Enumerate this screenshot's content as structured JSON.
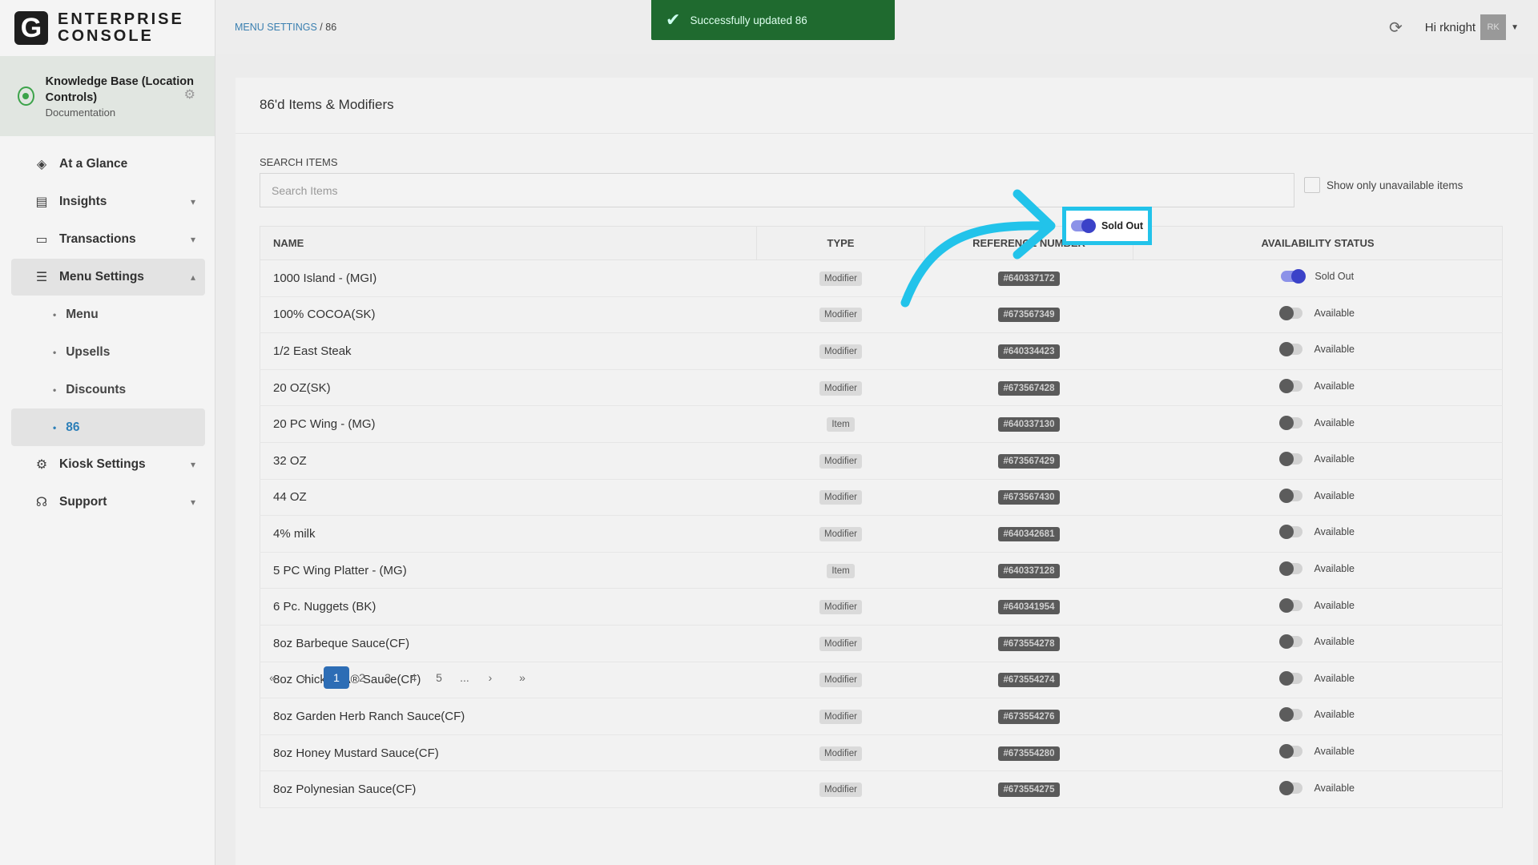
{
  "logo": {
    "mark": "G",
    "line1": "ENTERPRISE",
    "line2": "CONSOLE"
  },
  "location": {
    "name": "Knowledge Base (Location Controls)",
    "sub": "Documentation"
  },
  "nav": {
    "at_a_glance": "At a Glance",
    "insights": "Insights",
    "transactions": "Transactions",
    "menu_settings": "Menu Settings",
    "sub_menu": "Menu",
    "sub_upsells": "Upsells",
    "sub_discounts": "Discounts",
    "sub_86": "86",
    "kiosk_settings": "Kiosk Settings",
    "support": "Support"
  },
  "breadcrumb": {
    "parent": "MENU SETTINGS",
    "sep": "/",
    "current": "86"
  },
  "toast": {
    "message": "Successfully updated 86"
  },
  "user": {
    "greeting": "Hi rknight",
    "initials": "RK"
  },
  "page": {
    "title": "86'd Items & Modifiers",
    "search_label": "SEARCH ITEMS",
    "search_placeholder": "Search Items",
    "only_unavailable": "Show only unavailable items"
  },
  "table": {
    "headers": {
      "name": "NAME",
      "type": "TYPE",
      "ref": "REFERENCE NUMBER",
      "status": "AVAILABILITY STATUS"
    },
    "rows": [
      {
        "name": "1000 Island - (MGI)",
        "type": "Modifier",
        "ref": "#640337172",
        "status": "Sold Out",
        "on": true
      },
      {
        "name": "100% COCOA(SK)",
        "type": "Modifier",
        "ref": "#673567349",
        "status": "Available",
        "on": false
      },
      {
        "name": "1/2 East Steak",
        "type": "Modifier",
        "ref": "#640334423",
        "status": "Available",
        "on": false
      },
      {
        "name": "20 OZ(SK)",
        "type": "Modifier",
        "ref": "#673567428",
        "status": "Available",
        "on": false
      },
      {
        "name": "20 PC Wing - (MG)",
        "type": "Item",
        "ref": "#640337130",
        "status": "Available",
        "on": false
      },
      {
        "name": "32 OZ",
        "type": "Modifier",
        "ref": "#673567429",
        "status": "Available",
        "on": false
      },
      {
        "name": "44 OZ",
        "type": "Modifier",
        "ref": "#673567430",
        "status": "Available",
        "on": false
      },
      {
        "name": "4% milk",
        "type": "Modifier",
        "ref": "#640342681",
        "status": "Available",
        "on": false
      },
      {
        "name": "5 PC Wing Platter - (MG)",
        "type": "Item",
        "ref": "#640337128",
        "status": "Available",
        "on": false
      },
      {
        "name": "6 Pc. Nuggets (BK)",
        "type": "Modifier",
        "ref": "#640341954",
        "status": "Available",
        "on": false
      },
      {
        "name": "8oz Barbeque Sauce(CF)",
        "type": "Modifier",
        "ref": "#673554278",
        "status": "Available",
        "on": false
      },
      {
        "name": "8oz Chick-fil-A® Sauce(CF)",
        "type": "Modifier",
        "ref": "#673554274",
        "status": "Available",
        "on": false
      },
      {
        "name": "8oz Garden Herb Ranch Sauce(CF)",
        "type": "Modifier",
        "ref": "#673554276",
        "status": "Available",
        "on": false
      },
      {
        "name": "8oz Honey Mustard Sauce(CF)",
        "type": "Modifier",
        "ref": "#673554280",
        "status": "Available",
        "on": false
      },
      {
        "name": "8oz Polynesian Sauce(CF)",
        "type": "Modifier",
        "ref": "#673554275",
        "status": "Available",
        "on": false
      }
    ]
  },
  "pagination": {
    "first": "«",
    "prev": "‹",
    "pages": [
      "1",
      "2",
      "3",
      "4",
      "5",
      "..."
    ],
    "next": "›",
    "last": "»",
    "current": "1"
  },
  "colors": {
    "accent": "#22c3ea",
    "primary": "#2d6db5",
    "toast": "#1f6a2f"
  }
}
